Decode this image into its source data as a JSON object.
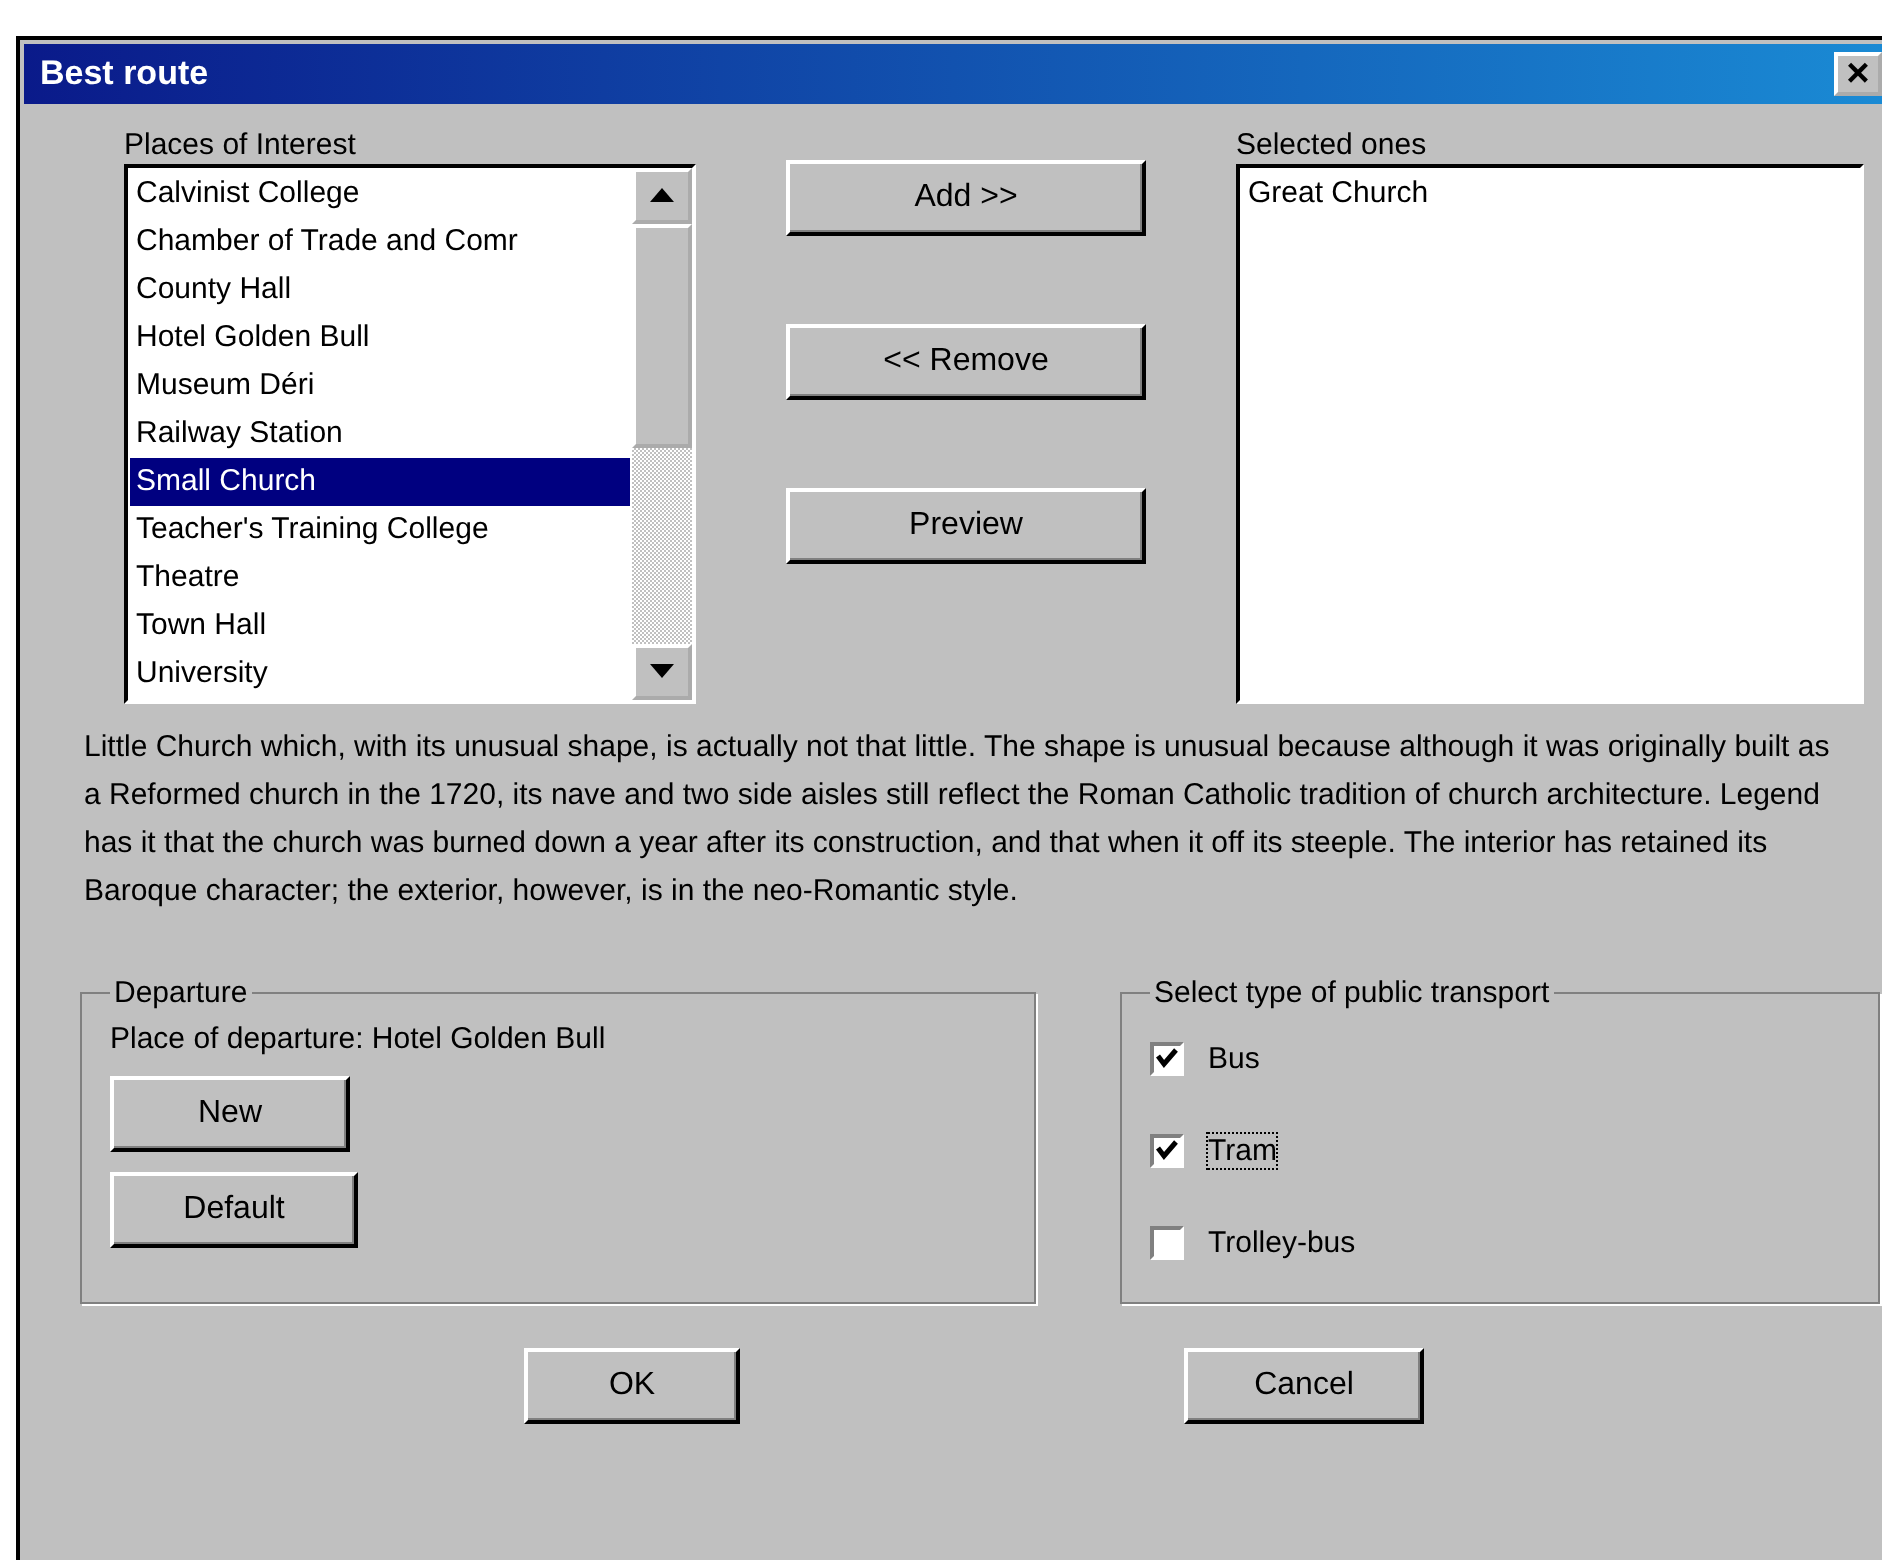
{
  "window": {
    "title": "Best route",
    "close": "×"
  },
  "places": {
    "label": "Places of Interest",
    "items": [
      {
        "name": "Calvinist College",
        "selected": false
      },
      {
        "name": "Chamber of Trade and Comr",
        "selected": false
      },
      {
        "name": "County Hall",
        "selected": false
      },
      {
        "name": "Hotel Golden Bull",
        "selected": false
      },
      {
        "name": "Museum Déri",
        "selected": false
      },
      {
        "name": "Railway Station",
        "selected": false
      },
      {
        "name": "Small Church",
        "selected": true
      },
      {
        "name": "Teacher's Training College",
        "selected": false
      },
      {
        "name": "Theatre",
        "selected": false
      },
      {
        "name": "Town Hall",
        "selected": false
      },
      {
        "name": "University",
        "selected": false
      }
    ]
  },
  "actions": [
    "Add >>",
    "<< Remove",
    "Preview"
  ],
  "selected_list": {
    "label": "Selected ones",
    "items": [
      "Great Church"
    ]
  },
  "description": "Little Church which, with its unusual shape, is actually not that little. The shape is unusual because although it was originally built as a Reformed church in the 1720, its nave and two side aisles still reflect the Roman Catholic tradition of church architecture. Legend has it that the church was burned down a year after its construction, and that when it off its steeple. The interior has retained its Baroque character; the exterior, however, is in the neo-Romantic style.",
  "departure": {
    "title": "Departure",
    "place": "Place of departure: Hotel Golden Bull",
    "buttons": [
      "New",
      "Default"
    ]
  },
  "transport": {
    "title": "Select type of public transport",
    "options": [
      {
        "label": "Bus",
        "checked": true,
        "focused": false
      },
      {
        "label": "Tram",
        "checked": true,
        "focused": true
      },
      {
        "label": "Trolley-bus",
        "checked": false,
        "focused": false
      }
    ]
  },
  "buttons": [
    "OK",
    "Cancel"
  ]
}
